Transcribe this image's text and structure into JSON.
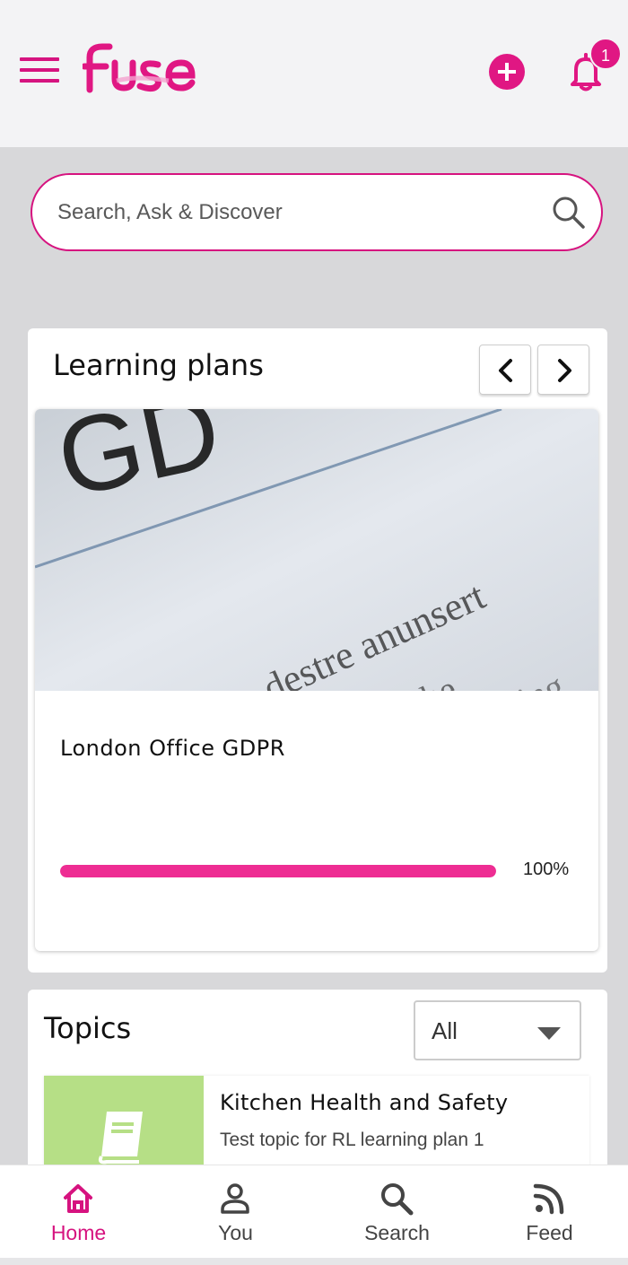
{
  "header": {
    "logo_text": "Fuse",
    "notification_count": "1"
  },
  "search": {
    "placeholder": "Search, Ask & Discover"
  },
  "learning_plans": {
    "title": "Learning plans",
    "items": [
      {
        "name": "London Office GDPR",
        "progress_percent": 100,
        "progress_label": "100%",
        "image_text": [
          "GD",
          "the destre anunsert",
          "the roache",
          "ting"
        ]
      }
    ]
  },
  "topics": {
    "title": "Topics",
    "filter_value": "All",
    "items": [
      {
        "name": "Kitchen Health and Safety",
        "description": "Test topic for RL learning plan 1"
      }
    ]
  },
  "bottom_nav": {
    "tabs": [
      {
        "label": "Home",
        "icon": "home-icon",
        "active": true
      },
      {
        "label": "You",
        "icon": "user-icon",
        "active": false
      },
      {
        "label": "Search",
        "icon": "search-icon",
        "active": false
      },
      {
        "label": "Feed",
        "icon": "rss-icon",
        "active": false
      }
    ]
  },
  "colors": {
    "brand": "#d6137f",
    "progress": "#ee2d93",
    "topic_thumb": "#b6df86"
  }
}
